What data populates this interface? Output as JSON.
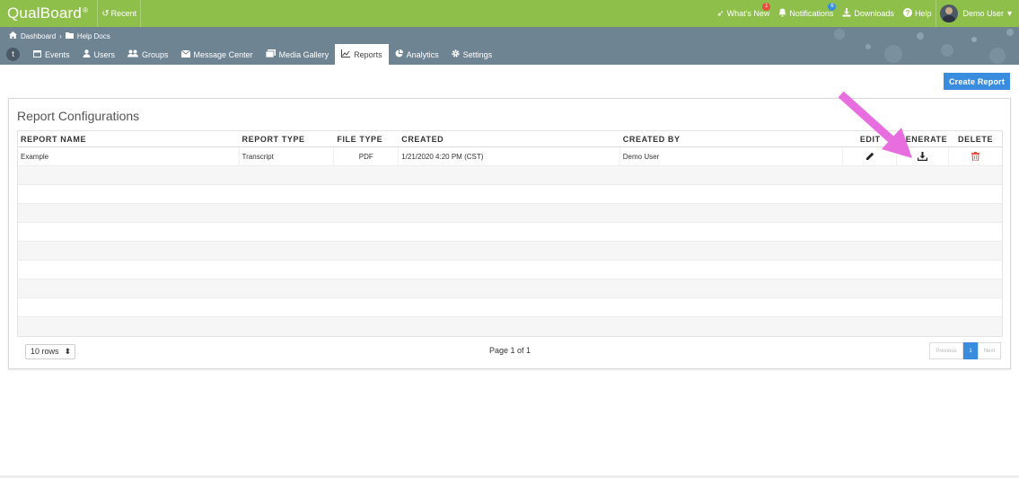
{
  "topbar": {
    "brand": "QualBoard",
    "brand_mark": "®",
    "recent_label": "Recent",
    "whats_new_label": "What's New",
    "whats_new_badge": "1",
    "notifications_label": "Notifications",
    "notifications_badge": "6",
    "downloads_label": "Downloads",
    "help_label": "Help",
    "user_label": "Demo User"
  },
  "breadcrumb": {
    "home": "Dashboard",
    "current": "Help Docs"
  },
  "tabs": [
    {
      "label": "Events",
      "icon": "calendar-icon"
    },
    {
      "label": "Users",
      "icon": "user-icon"
    },
    {
      "label": "Groups",
      "icon": "group-icon"
    },
    {
      "label": "Message Center",
      "icon": "envelope-icon"
    },
    {
      "label": "Media Gallery",
      "icon": "media-icon"
    },
    {
      "label": "Reports",
      "icon": "line-chart-icon",
      "active": true
    },
    {
      "label": "Analytics",
      "icon": "pie-chart-icon"
    },
    {
      "label": "Settings",
      "icon": "gear-icon"
    }
  ],
  "create_button_label": "Create Report",
  "panel": {
    "title": "Report Configurations",
    "columns": [
      "REPORT NAME",
      "REPORT TYPE",
      "FILE TYPE",
      "CREATED",
      "CREATED BY",
      "EDIT",
      "GENERATE",
      "DELETE"
    ],
    "rows": [
      {
        "name": "Example",
        "type": "Transcript",
        "file_type": "PDF",
        "created": "1/21/2020 4:20 PM (CST)",
        "created_by": "Demo User"
      }
    ],
    "pagination": {
      "rows_label": "10 rows",
      "page_info": "Page 1 of 1",
      "prev": "Previous",
      "current": "1",
      "next": "Next"
    }
  },
  "colors": {
    "topbar": "#8ebf4a",
    "nav": "#6f8493",
    "accent": "#3a8dde",
    "delete": "#e74c3c",
    "arrow": "#e86ee0"
  }
}
